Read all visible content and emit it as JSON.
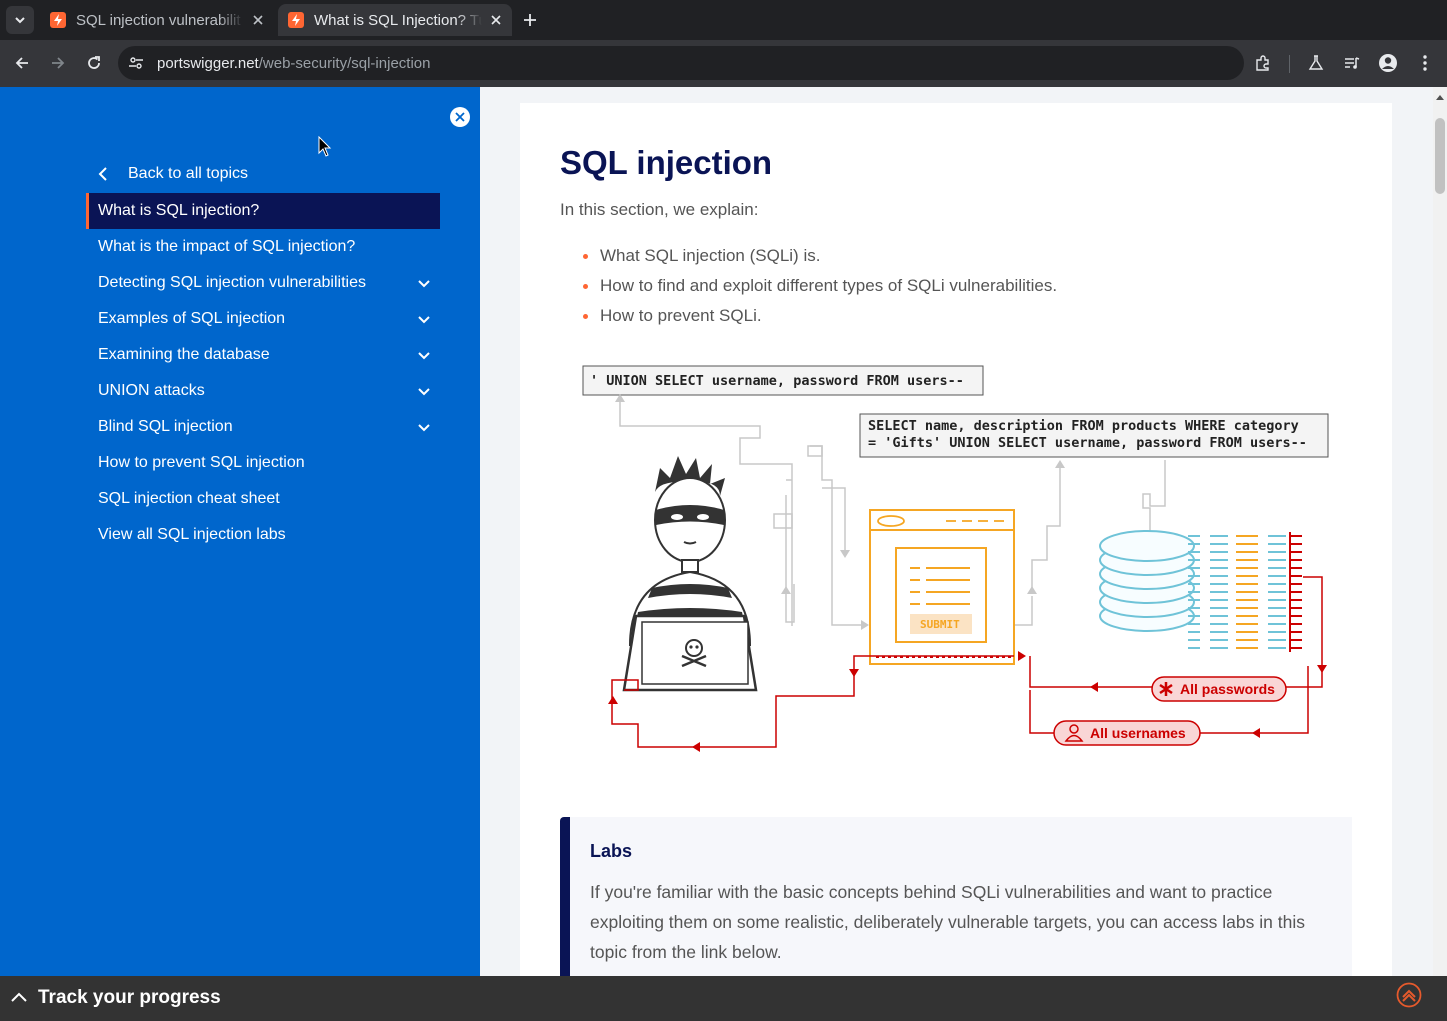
{
  "browser": {
    "tabs": [
      {
        "title": "SQL injection vulnerabilit",
        "active": false
      },
      {
        "title": "What is SQL Injection? Tu",
        "active": true
      }
    ],
    "url_host": "portswigger.net",
    "url_path": "/web-security/sql-injection"
  },
  "sidebar": {
    "back_label": "Back to all topics",
    "items": [
      {
        "label": "What is SQL injection?",
        "active": true,
        "expandable": false
      },
      {
        "label": "What is the impact of SQL injection?",
        "expandable": false
      },
      {
        "label": "Detecting SQL injection vulnerabilities",
        "expandable": true
      },
      {
        "label": "Examples of SQL injection",
        "expandable": true
      },
      {
        "label": "Examining the database",
        "expandable": true
      },
      {
        "label": "UNION attacks",
        "expandable": true
      },
      {
        "label": "Blind SQL injection",
        "expandable": true
      },
      {
        "label": "How to prevent SQL injection",
        "expandable": false
      },
      {
        "label": "SQL injection cheat sheet",
        "expandable": false
      },
      {
        "label": "View all SQL injection labs",
        "expandable": false
      }
    ]
  },
  "article": {
    "title": "SQL injection",
    "intro": "In this section, we explain:",
    "bullets": [
      "What SQL injection (SQLi) is.",
      "How to find and exploit different types of SQLi vulnerabilities.",
      "How to prevent SQLi."
    ],
    "diagram": {
      "payload": "' UNION SELECT username, password FROM users--",
      "query_line1": "SELECT name, description FROM products WHERE category",
      "query_line2": "= 'Gifts' UNION SELECT username, password FROM users--",
      "submit": "SUBMIT",
      "result_passwords": "All passwords",
      "result_usernames": "All usernames"
    },
    "labs": {
      "heading": "Labs",
      "text": "If you're familiar with the basic concepts behind SQLi vulnerabilities and want to practice exploiting them on some realistic, deliberately vulnerable targets, you can access labs in this topic from the link below."
    }
  },
  "footer": {
    "progress_label": "Track your progress"
  },
  "colors": {
    "sidebar": "#0066cc",
    "active_item": "#0a1455",
    "accent": "#ff6633",
    "heading": "#0a1455"
  }
}
